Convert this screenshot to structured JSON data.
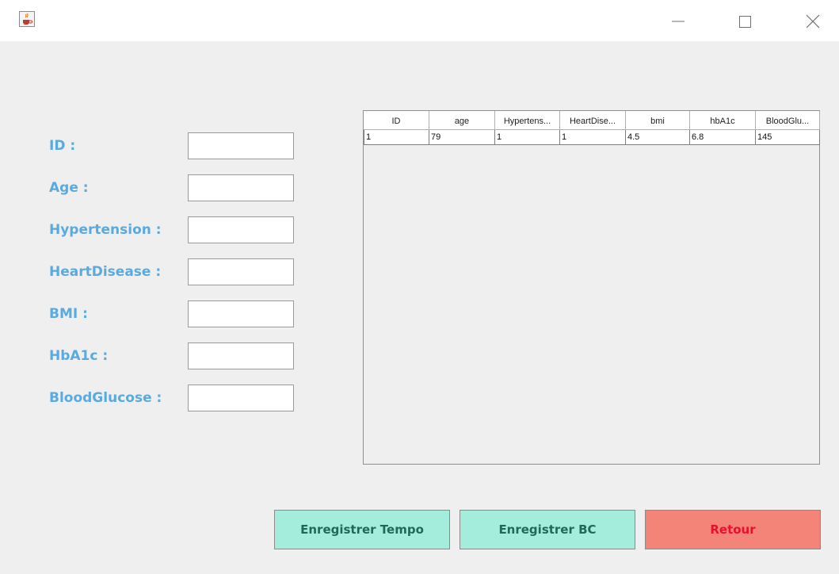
{
  "window": {
    "icons": {
      "app": "java-cup-icon",
      "minimize": "minimize-icon",
      "maximize": "maximize-icon",
      "close": "close-icon"
    }
  },
  "form": {
    "fields": [
      {
        "label": "ID :",
        "value": ""
      },
      {
        "label": "Age :",
        "value": ""
      },
      {
        "label": "Hypertension :",
        "value": ""
      },
      {
        "label": "HeartDisease :",
        "value": ""
      },
      {
        "label": "BMI :",
        "value": ""
      },
      {
        "label": "HbA1c :",
        "value": ""
      },
      {
        "label": "BloodGlucose :",
        "value": ""
      }
    ],
    "label_color": "#5aaadf"
  },
  "table": {
    "columns": [
      "ID",
      "age",
      "Hypertens...",
      "HeartDise...",
      "bmi",
      "hbA1c",
      "BloodGlu..."
    ],
    "rows": [
      [
        "1",
        "79",
        "1",
        "1",
        "4.5",
        "6.8",
        "145"
      ]
    ]
  },
  "buttons": {
    "tempo": "Enregistrer Tempo",
    "bc": "Enregistrer BC",
    "retour": "Retour"
  },
  "colors": {
    "save_button_bg": "#a4ecdc",
    "save_button_text": "#1f6a56",
    "back_button_bg": "#f48378",
    "back_button_text": "#e8102e"
  }
}
